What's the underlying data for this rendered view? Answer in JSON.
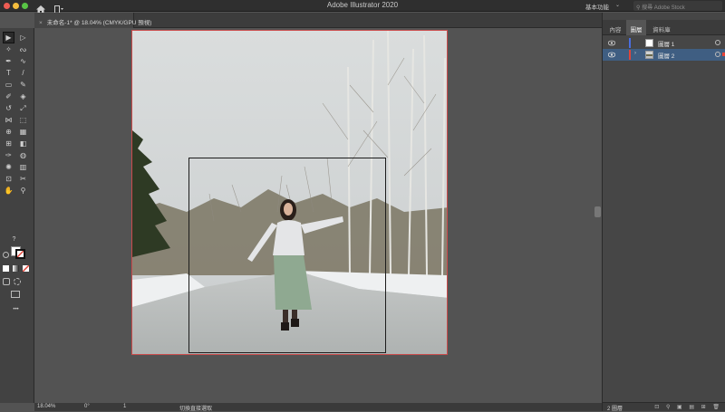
{
  "app": {
    "title": "Adobe Illustrator 2020",
    "workspace": "基本功能",
    "stock_search_placeholder": "搜尋 Adobe Stock"
  },
  "document_tab": {
    "close_label": "×",
    "label": "未命名-1* @ 18.04% (CMYK/GPU 預視)"
  },
  "tools": [
    {
      "name": "selection-tool",
      "glyph": "▶"
    },
    {
      "name": "direct-selection-tool",
      "glyph": "▷"
    },
    {
      "name": "magic-wand-tool",
      "glyph": "✧"
    },
    {
      "name": "lasso-tool",
      "glyph": "ᔓ"
    },
    {
      "name": "pen-tool",
      "glyph": "✒"
    },
    {
      "name": "curvature-tool",
      "glyph": "∿"
    },
    {
      "name": "type-tool",
      "glyph": "T"
    },
    {
      "name": "line-tool",
      "glyph": "/"
    },
    {
      "name": "rectangle-tool",
      "glyph": "▭"
    },
    {
      "name": "paintbrush-tool",
      "glyph": "✎"
    },
    {
      "name": "shaper-tool",
      "glyph": "✐"
    },
    {
      "name": "eraser-tool",
      "glyph": "◈"
    },
    {
      "name": "rotate-tool",
      "glyph": "↺"
    },
    {
      "name": "scale-tool",
      "glyph": "⤢"
    },
    {
      "name": "width-tool",
      "glyph": "⋈"
    },
    {
      "name": "free-transform-tool",
      "glyph": "⬚"
    },
    {
      "name": "shape-builder-tool",
      "glyph": "⊕"
    },
    {
      "name": "perspective-grid-tool",
      "glyph": "▦"
    },
    {
      "name": "mesh-tool",
      "glyph": "⊞"
    },
    {
      "name": "gradient-tool",
      "glyph": "◧"
    },
    {
      "name": "eyedropper-tool",
      "glyph": "✑"
    },
    {
      "name": "blend-tool",
      "glyph": "◍"
    },
    {
      "name": "symbol-sprayer-tool",
      "glyph": "✺"
    },
    {
      "name": "column-graph-tool",
      "glyph": "▥"
    },
    {
      "name": "artboard-tool",
      "glyph": "⊡"
    },
    {
      "name": "slice-tool",
      "glyph": "✂"
    },
    {
      "name": "hand-tool",
      "glyph": "✋"
    },
    {
      "name": "zoom-tool",
      "glyph": "⚲"
    }
  ],
  "fill_stroke_help": "?",
  "more_tools": "•••",
  "status": {
    "zoom": "18.04%",
    "rotation": "0°",
    "artboard_number": "1",
    "tool_name": "切換直接選取"
  },
  "panel": {
    "tabs": [
      "內容",
      "圖層",
      "資料庫"
    ],
    "active_tab": 1,
    "layers": [
      {
        "name": "圖層 1",
        "color": "#4a6ee0",
        "selected": false,
        "has_arrow": false
      },
      {
        "name": "圖層 2",
        "color": "#e0453a",
        "selected": true,
        "has_arrow": true
      }
    ],
    "layer_count": "2 圖層",
    "bottom_icons": "⊡ ⚲ ▣ ▤ ⊞ 🗑"
  },
  "colors": {
    "accent_selection": "#3f5e82",
    "artboard_border": "#c94b4b"
  }
}
